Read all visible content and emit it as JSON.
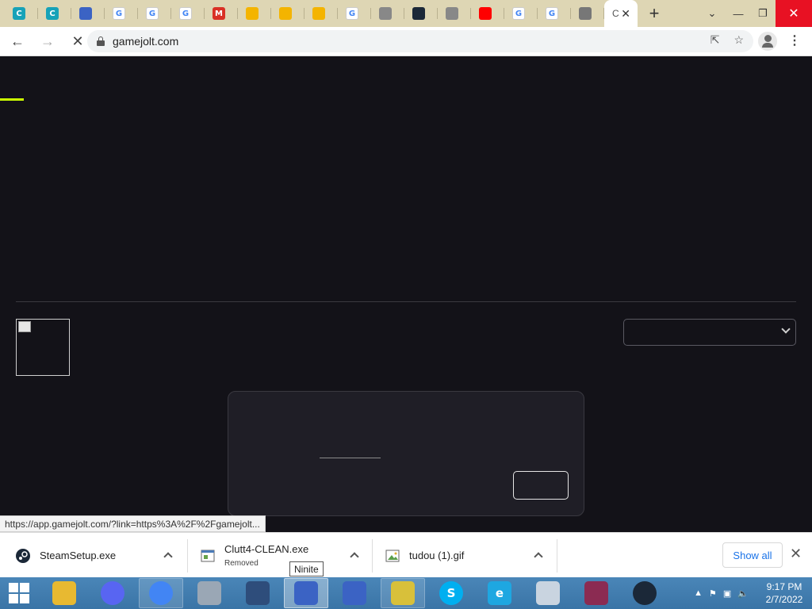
{
  "browser": {
    "tabs": [
      {
        "icon": "canva-icon",
        "color": "#17a2b8",
        "glyph": "C"
      },
      {
        "icon": "canva-icon",
        "color": "#17a2b8",
        "glyph": "C"
      },
      {
        "icon": "ninite-icon",
        "color": "#3b63c4",
        "glyph": ""
      },
      {
        "icon": "google-icon",
        "color": "#ffffff",
        "glyph": "G"
      },
      {
        "icon": "google-icon",
        "color": "#ffffff",
        "glyph": "G"
      },
      {
        "icon": "google-icon",
        "color": "#ffffff",
        "glyph": "G"
      },
      {
        "icon": "gmail-icon",
        "color": "#d93025",
        "glyph": "M"
      },
      {
        "icon": "drive-icon",
        "color": "#f4b400",
        "glyph": ""
      },
      {
        "icon": "drive-icon",
        "color": "#f4b400",
        "glyph": ""
      },
      {
        "icon": "drive-icon",
        "color": "#f4b400",
        "glyph": ""
      },
      {
        "icon": "google-icon",
        "color": "#ffffff",
        "glyph": "G"
      },
      {
        "icon": "globe-icon",
        "color": "#888888",
        "glyph": ""
      },
      {
        "icon": "steam-icon",
        "color": "#1b2838",
        "glyph": ""
      },
      {
        "icon": "globe-icon",
        "color": "#888888",
        "glyph": ""
      },
      {
        "icon": "youtube-icon",
        "color": "#ff0000",
        "glyph": ""
      },
      {
        "icon": "google-icon",
        "color": "#ffffff",
        "glyph": "G"
      },
      {
        "icon": "google-icon",
        "color": "#ffffff",
        "glyph": "G"
      },
      {
        "icon": "chrome-icon",
        "color": "#777777",
        "glyph": ""
      }
    ],
    "active_tab_label": "C",
    "new_tab_label": "+",
    "url": "gamejolt.com",
    "status_url": "https://app.gamejolt.com/?link=https%3A%2F%2Fgamejolt..."
  },
  "downloads": {
    "items": [
      {
        "name": "SteamSetup.exe",
        "sub": ""
      },
      {
        "name": "Clutt4-CLEAN.exe",
        "sub": "Removed"
      },
      {
        "name": "tudou (1).gif",
        "sub": ""
      }
    ],
    "show_all_label": "Show all",
    "tooltip": "Ninite"
  },
  "taskbar": {
    "apps": [
      {
        "name": "file-explorer",
        "color": "#e8b931",
        "glyph": "",
        "state": "normal"
      },
      {
        "name": "discord",
        "color": "#5865f2",
        "glyph": "",
        "state": "normal"
      },
      {
        "name": "chrome",
        "color": "#4285f4",
        "glyph": "",
        "state": "open"
      },
      {
        "name": "disk-utility",
        "color": "#9aa7b5",
        "glyph": "",
        "state": "normal"
      },
      {
        "name": "paint-app",
        "color": "#2e4d7b",
        "glyph": "",
        "state": "normal"
      },
      {
        "name": "ninite",
        "color": "#3b63c4",
        "glyph": "",
        "state": "active"
      },
      {
        "name": "ninite",
        "color": "#3b63c4",
        "glyph": "",
        "state": "normal"
      },
      {
        "name": "tudou",
        "color": "#d8c03a",
        "glyph": "",
        "state": "open"
      },
      {
        "name": "skype",
        "color": "#00aff0",
        "glyph": "S",
        "state": "normal"
      },
      {
        "name": "internet-explorer",
        "color": "#1ea7e1",
        "glyph": "e",
        "state": "normal"
      },
      {
        "name": "paint-palette",
        "color": "#c9d4e0",
        "glyph": "",
        "state": "normal"
      },
      {
        "name": "winrar",
        "color": "#8b2b52",
        "glyph": "",
        "state": "normal"
      },
      {
        "name": "steam",
        "color": "#1b2838",
        "glyph": "",
        "state": "normal"
      }
    ],
    "time": "9:17 PM",
    "date": "2/7/2022"
  }
}
